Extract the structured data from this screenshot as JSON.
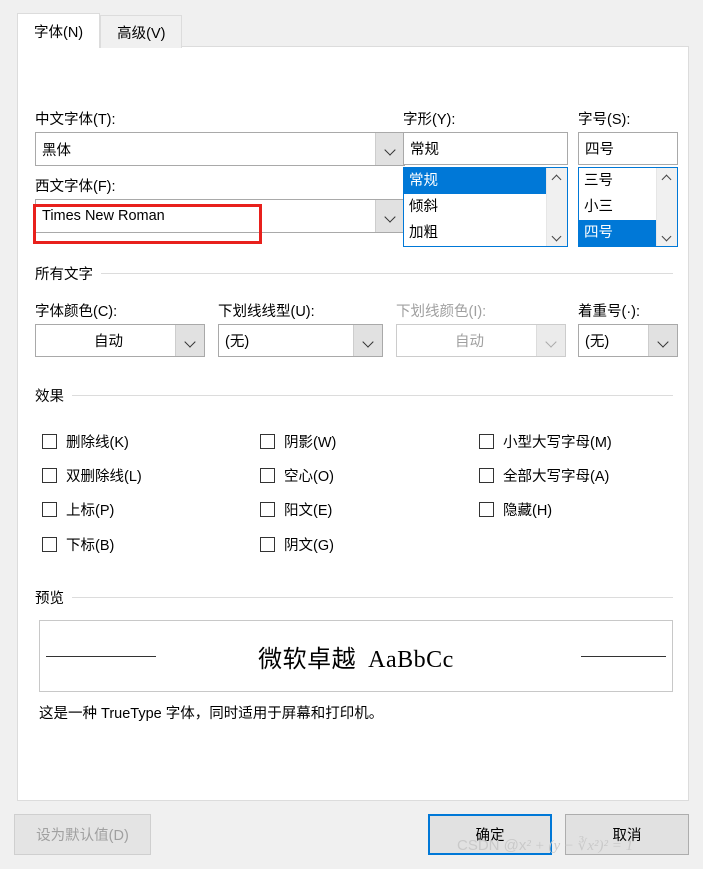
{
  "tabs": [
    {
      "label": "字体(N)",
      "mnemonic": "N",
      "active": true
    },
    {
      "label": "高级(V)",
      "mnemonic": "V",
      "active": false
    }
  ],
  "fields": {
    "cn_font_label": "中文字体(T):",
    "cn_font_value": "黑体",
    "west_font_label": "西文字体(F):",
    "west_font_value": "Times New Roman",
    "style_label": "字形(Y):",
    "style_value": "常规",
    "style_options": [
      "常规",
      "倾斜",
      "加粗"
    ],
    "style_selected_index": 0,
    "size_label": "字号(S):",
    "size_value": "四号",
    "size_options": [
      "三号",
      "小三",
      "四号"
    ],
    "size_selected_index": 2
  },
  "all_text_group": {
    "title": "所有文字",
    "font_color_label": "字体颜色(C):",
    "font_color_value": "自动",
    "underline_style_label": "下划线线型(U):",
    "underline_style_value": "(无)",
    "underline_color_label": "下划线颜色(I):",
    "underline_color_value": "自动",
    "underline_color_disabled": true,
    "emphasis_label": "着重号(·):",
    "emphasis_value": "(无)"
  },
  "effects_group": {
    "title": "效果",
    "column1": [
      {
        "label": "删除线(K)",
        "checked": false
      },
      {
        "label": "双删除线(L)",
        "checked": false
      },
      {
        "label": "上标(P)",
        "checked": false
      },
      {
        "label": "下标(B)",
        "checked": false
      }
    ],
    "column2": [
      {
        "label": "阴影(W)",
        "checked": false
      },
      {
        "label": "空心(O)",
        "checked": false
      },
      {
        "label": "阳文(E)",
        "checked": false
      },
      {
        "label": "阴文(G)",
        "checked": false
      }
    ],
    "column3": [
      {
        "label": "小型大写字母(M)",
        "checked": false
      },
      {
        "label": "全部大写字母(A)",
        "checked": false
      },
      {
        "label": "隐藏(H)",
        "checked": false
      }
    ]
  },
  "preview_group": {
    "title": "预览",
    "sample_cjk": "微软卓越",
    "sample_latin": "AaBbCc",
    "description": "这是一种 TrueType 字体，同时适用于屏幕和打印机。"
  },
  "footer": {
    "set_default_label": "设为默认值(D)",
    "set_default_disabled": true,
    "ok_label": "确定",
    "cancel_label": "取消"
  },
  "watermark": {
    "prefix": "CSDN @x",
    "formula": "² + (y − ∛x²)² = 1"
  },
  "colors": {
    "accent": "#0078d7",
    "annotation_red": "#e8201c",
    "dialog_bg": "#f0f0f0",
    "panel_bg": "#ffffff"
  }
}
